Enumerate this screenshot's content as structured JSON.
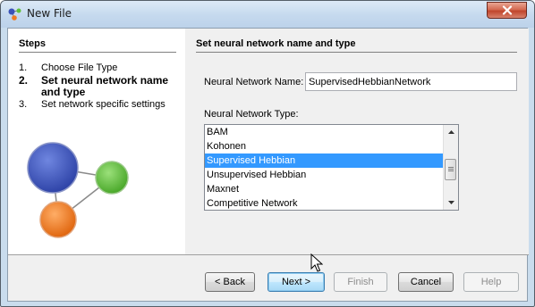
{
  "window": {
    "title": "New File"
  },
  "steps": {
    "title": "Steps",
    "items": [
      {
        "num": "1.",
        "label": "Choose File Type"
      },
      {
        "num": "2.",
        "label": "Set neural network name and type"
      },
      {
        "num": "3.",
        "label": "Set network specific settings"
      }
    ]
  },
  "content": {
    "title": "Set neural network name and type",
    "name_label": "Neural Network Name:",
    "name_value": "SupervisedHebbianNetwork",
    "type_label": "Neural Network Type:",
    "types": [
      "BAM",
      "Kohonen",
      "Supervised Hebbian",
      "Unsupervised Hebbian",
      "Maxnet",
      "Competitive Network"
    ],
    "selected_type": "Supervised Hebbian"
  },
  "buttons": {
    "back": "< Back",
    "next": "Next >",
    "finish": "Finish",
    "cancel": "Cancel",
    "help": "Help"
  },
  "colors": {
    "selection": "#3399ff",
    "node_blue": "#3a52b8",
    "node_green": "#5fbf3a",
    "node_orange": "#f07a22"
  }
}
